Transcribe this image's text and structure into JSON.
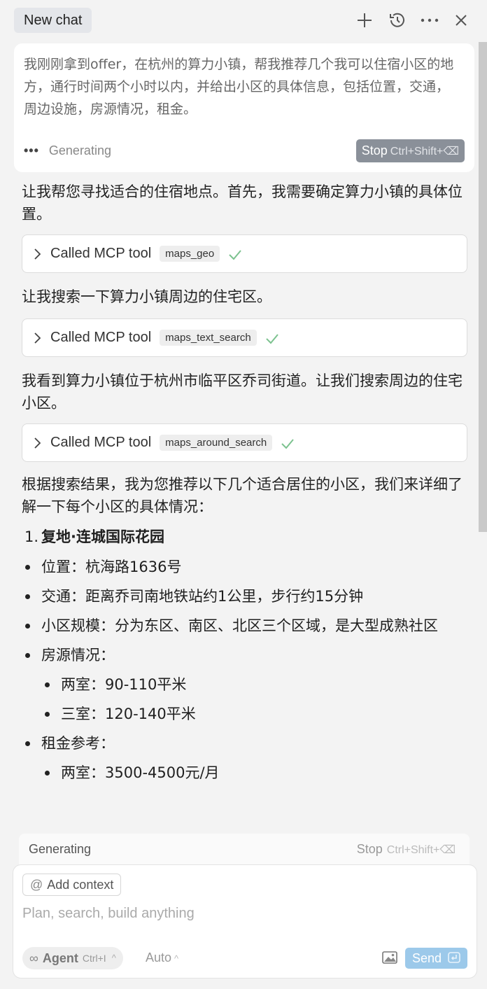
{
  "header": {
    "tab_label": "New chat",
    "icons": [
      "plus-icon",
      "history-icon",
      "more-icon",
      "close-icon"
    ]
  },
  "user_message": {
    "text": "我刚刚拿到offer，在杭州的算力小镇，帮我推荐几个我可以住宿小区的地方，通行时间两个小时以内，并给出小区的具体信息，包括位置，交通，周边设施，房源情况，租金。",
    "status_dots": "•••",
    "status": "Generating",
    "stop_label": "Stop",
    "stop_shortcut": "Ctrl+Shift+⌫"
  },
  "transcript": {
    "intro": "让我帮您寻找适合的住宿地点。首先，我需要确定算力小镇的具体位置。",
    "tool_prefix": "Called MCP tool",
    "tool1": "maps_geo",
    "para2": "让我搜索一下算力小镇周边的住宅区。",
    "tool2": "maps_text_search",
    "para3": "我看到算力小镇位于杭州市临平区乔司街道。让我们搜索周边的住宅小区。",
    "tool3": "maps_around_search",
    "para4": "根据搜索结果，我为您推荐以下几个适合居住的小区，我们来详细了解一下每个小区的具体情况：",
    "item1_num": "1.",
    "item1_title": "复地·连城国际花园",
    "b_location": "位置：杭海路1636号",
    "b_transport": "交通：距离乔司南地铁站约1公里，步行约15分钟",
    "b_scale": "小区规模：分为东区、南区、北区三个区域，是大型成熟社区",
    "b_housing": "房源情况：",
    "b_housing_2": "两室：90-110平米",
    "b_housing_3": "三室：120-140平米",
    "b_rent": "租金参考：",
    "b_rent_2": "两室：3500-4500元/月"
  },
  "gen_bar": {
    "label": "Generating",
    "stop": "Stop",
    "shortcut": "Ctrl+Shift+⌫"
  },
  "composer": {
    "add_context_at": "@",
    "add_context": "Add context",
    "placeholder": "Plan, search, build anything",
    "agent_symbol": "∞",
    "agent_label": "Agent",
    "agent_shortcut": "Ctrl+I",
    "caret": "^",
    "model": "Auto",
    "send_label": "Send"
  }
}
